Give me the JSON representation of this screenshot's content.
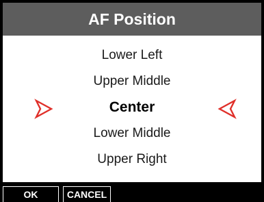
{
  "dialog": {
    "title": "AF Position",
    "options": [
      {
        "label": "Lower Left"
      },
      {
        "label": "Upper Middle"
      },
      {
        "label": "Center"
      },
      {
        "label": "Lower Middle"
      },
      {
        "label": "Upper Right"
      }
    ],
    "selected_label": "Center",
    "arrow_icon_left": "right-pointing-arrow-icon",
    "arrow_icon_right": "left-pointing-arrow-icon",
    "arrow_color": "#e0302a",
    "title_bar_color": "#5d5d5d"
  },
  "softkeys": {
    "ok_label": "OK",
    "cancel_label": "CANCEL"
  }
}
